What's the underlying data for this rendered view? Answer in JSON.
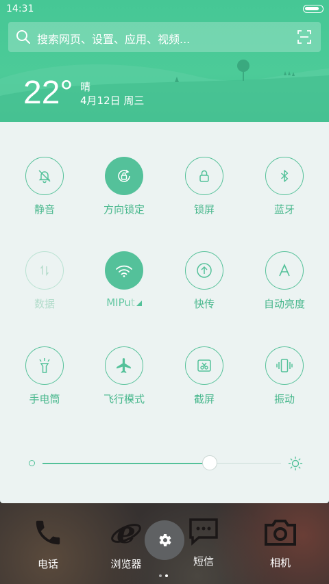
{
  "status": {
    "time": "14:31",
    "battery_level": 0.88
  },
  "search": {
    "placeholder": "搜索网页、设置、应用、视频..."
  },
  "weather": {
    "temperature": "22°",
    "condition": "晴",
    "date": "4月12日 周三"
  },
  "toggles": [
    {
      "label": "静音",
      "icon": "bell-off-icon",
      "state": "off"
    },
    {
      "label": "方向锁定",
      "icon": "rotation-lock-icon",
      "state": "on"
    },
    {
      "label": "锁屏",
      "icon": "lock-icon",
      "state": "off"
    },
    {
      "label": "蓝牙",
      "icon": "bluetooth-icon",
      "state": "off"
    },
    {
      "label": "数据",
      "icon": "mobile-data-icon",
      "state": "disabled"
    },
    {
      "label": "MIPu",
      "icon": "wifi-icon",
      "state": "on"
    },
    {
      "label": "快传",
      "icon": "quick-transfer-icon",
      "state": "off"
    },
    {
      "label": "自动亮度",
      "icon": "auto-brightness-icon",
      "state": "off"
    },
    {
      "label": "手电筒",
      "icon": "flashlight-icon",
      "state": "off"
    },
    {
      "label": "飞行模式",
      "icon": "airplane-icon",
      "state": "off"
    },
    {
      "label": "截屏",
      "icon": "screenshot-icon",
      "state": "off"
    },
    {
      "label": "振动",
      "icon": "vibrate-icon",
      "state": "off"
    }
  ],
  "brightness": {
    "level": 0.7
  },
  "dock": {
    "apps": [
      {
        "label": "电话",
        "icon": "phone-icon"
      },
      {
        "label": "浏览器",
        "icon": "browser-icon"
      },
      {
        "label": "短信",
        "icon": "sms-icon"
      },
      {
        "label": "相机",
        "icon": "camera-icon"
      }
    ],
    "page_count": 2,
    "active_page": 2
  },
  "colors": {
    "accent": "#54c19a",
    "header": "#4ccb98",
    "panel_bg": "#ecf3f2"
  }
}
